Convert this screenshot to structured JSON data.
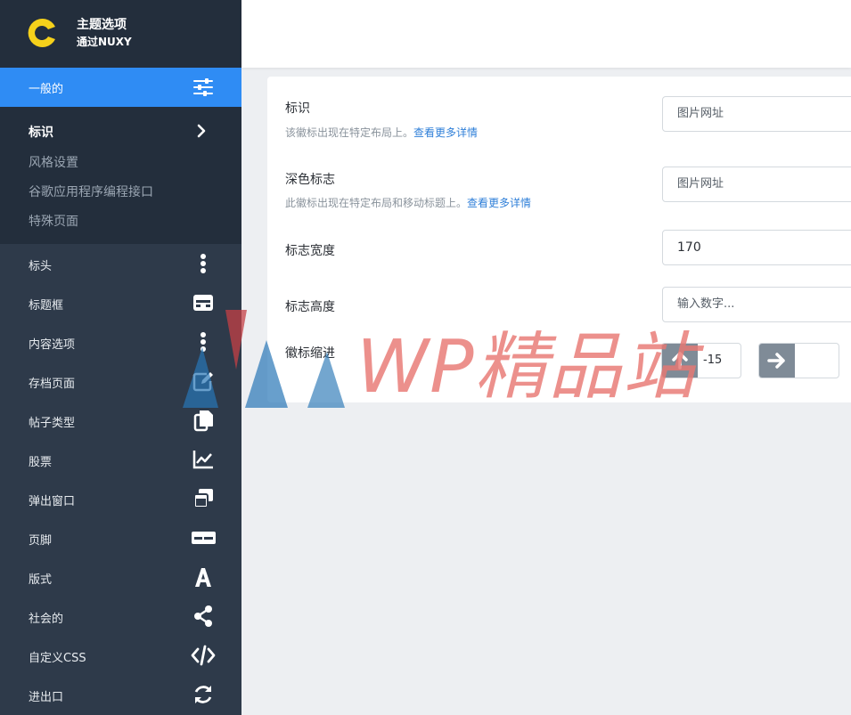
{
  "brand": {
    "title": "主题选项",
    "subtitle": "通过NUXY",
    "logo_color": "#f5d11b"
  },
  "colors": {
    "active": "#2f8cf4",
    "sidebar": "#2e3a4a",
    "sidebar_dark": "#232e3c",
    "link": "#2f7fd8",
    "stepper_button": "#7f8b97"
  },
  "nav": {
    "active": {
      "label": "一般的",
      "icon": "sliders-icon"
    },
    "submenu": [
      {
        "label": "标识",
        "current": true,
        "icon": "chevron-right-icon"
      },
      {
        "label": "风格设置"
      },
      {
        "label": "谷歌应用程序编程接口"
      },
      {
        "label": "特殊页面"
      }
    ],
    "items": [
      {
        "label": "标头",
        "icon": "vertical-dots-icon"
      },
      {
        "label": "标题框",
        "icon": "title-box-icon"
      },
      {
        "label": "内容选项",
        "icon": "vertical-dots-icon"
      },
      {
        "label": "存档页面",
        "icon": "edit-icon"
      },
      {
        "label": "帖子类型",
        "icon": "copy-icon"
      },
      {
        "label": "股票",
        "icon": "line-chart-icon"
      },
      {
        "label": "弹出窗口",
        "icon": "window-restore-icon"
      },
      {
        "label": "页脚",
        "icon": "footer-icon"
      },
      {
        "label": "版式",
        "icon": "font-icon"
      },
      {
        "label": "社会的",
        "icon": "share-icon"
      },
      {
        "label": "自定义CSS",
        "icon": "code-icon"
      },
      {
        "label": "进出口",
        "icon": "sync-icon"
      }
    ]
  },
  "fields": {
    "logo": {
      "label": "标识",
      "desc": "该徽标出现在特定布局上。",
      "link": "查看更多详情",
      "placeholder": "图片网址"
    },
    "dark_logo": {
      "label": "深色标志",
      "desc": "此徽标出现在特定布局和移动标题上。",
      "link": "查看更多详情",
      "placeholder": "图片网址"
    },
    "logo_width": {
      "label": "标志宽度",
      "value": "170"
    },
    "logo_height": {
      "label": "标志高度",
      "placeholder": "输入数字..."
    },
    "logo_indent": {
      "label": "徽标缩进",
      "top_value": "-15",
      "left_value": ""
    }
  },
  "watermark": {
    "text": "WP精品站"
  }
}
